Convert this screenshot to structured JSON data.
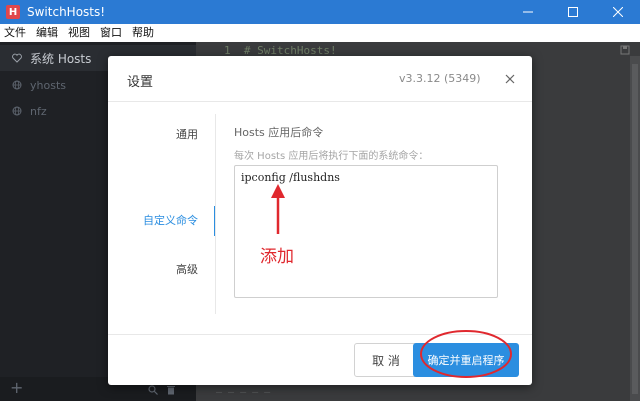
{
  "window": {
    "title": "SwitchHosts!",
    "app_icon_letter": "H",
    "accent_color": "#2b7ad3"
  },
  "menu": [
    "文件",
    "编辑",
    "视图",
    "窗口",
    "帮助"
  ],
  "sidebar": {
    "items": [
      {
        "label": "系统 Hosts",
        "icon": "heart-icon"
      },
      {
        "label": "yhosts",
        "icon": "globe-icon"
      },
      {
        "label": "nfz",
        "icon": "globe-icon"
      }
    ]
  },
  "editor": {
    "line_number": "1",
    "first_line": "# SwitchHosts!"
  },
  "modal": {
    "title": "设置",
    "version": "v3.3.12 (5349)",
    "tabs": [
      "通用",
      "自定义命令",
      "高级"
    ],
    "section_title": "Hosts 应用后命令",
    "section_desc": "每次 Hosts 应用后将执行下面的系统命令：",
    "command_value": "ipconfig /flushdns",
    "annotation": "添加",
    "cancel_label": "取 消",
    "confirm_label": "确定并重启程序",
    "accent_color": "#2b8ee0",
    "annotation_color": "#e0282e"
  }
}
